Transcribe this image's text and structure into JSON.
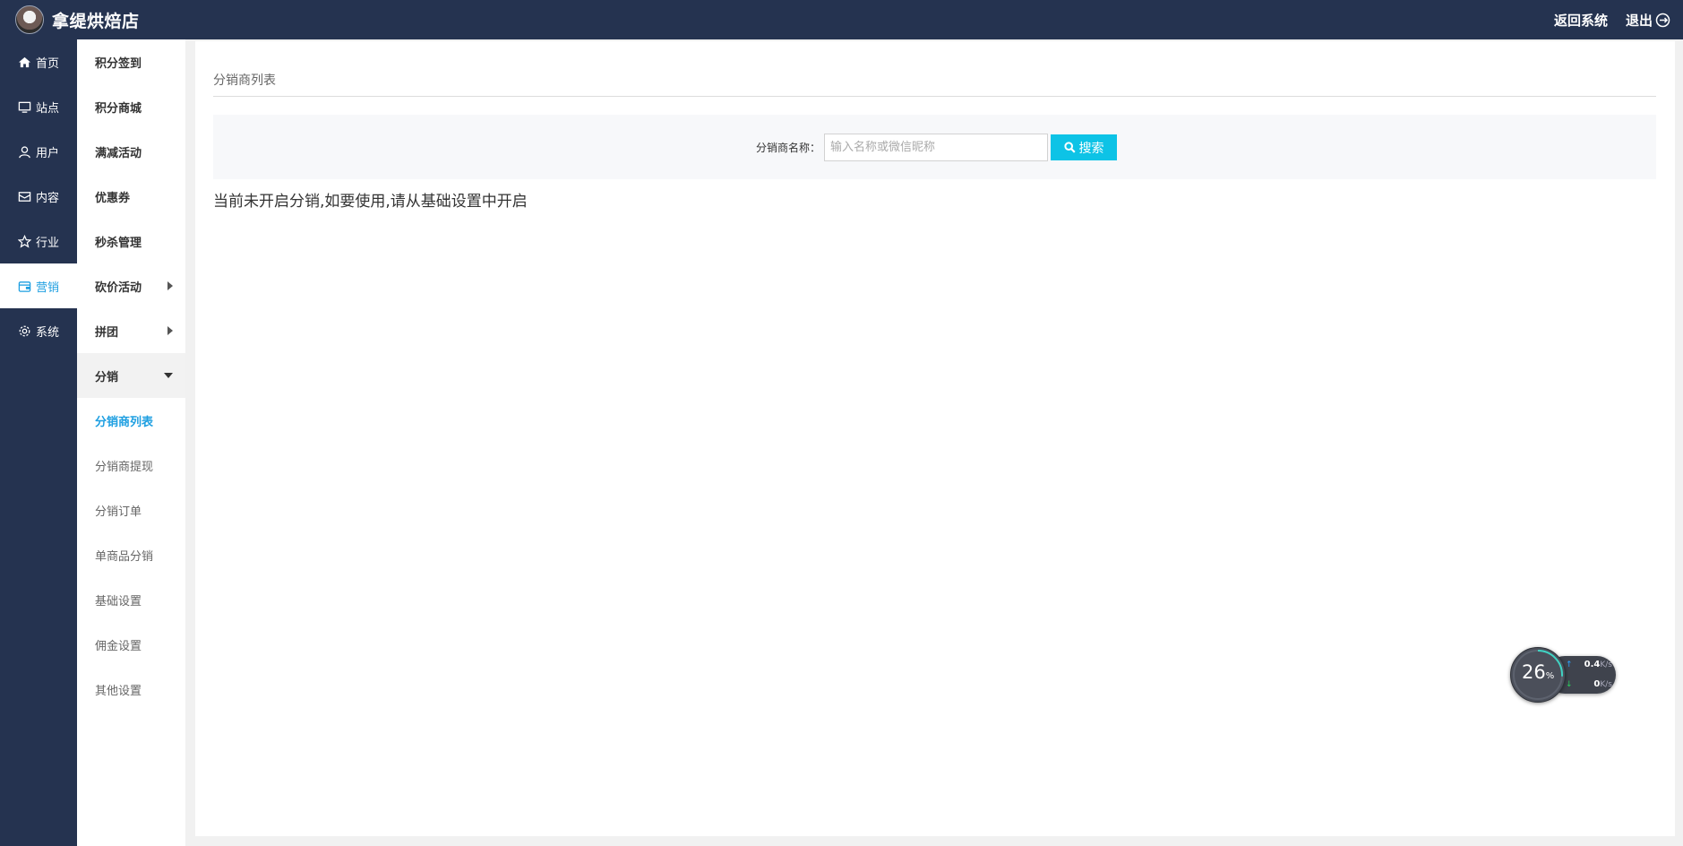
{
  "header": {
    "brand_name": "拿缇烘焙店",
    "return_label": "返回系统",
    "logout_label": "退出"
  },
  "primary_nav": [
    {
      "label": "首页",
      "icon": "home-icon",
      "active": false
    },
    {
      "label": "站点",
      "icon": "monitor-icon",
      "active": false
    },
    {
      "label": "用户",
      "icon": "user-icon",
      "active": false
    },
    {
      "label": "内容",
      "icon": "mail-icon",
      "active": false
    },
    {
      "label": "行业",
      "icon": "star-icon",
      "active": false
    },
    {
      "label": "营销",
      "icon": "wallet-icon",
      "active": true
    },
    {
      "label": "系统",
      "icon": "gear-icon",
      "active": false
    }
  ],
  "secondary_nav": {
    "items": [
      {
        "label": "积分签到"
      },
      {
        "label": "积分商城"
      },
      {
        "label": "满减活动"
      },
      {
        "label": "优惠券"
      },
      {
        "label": "秒杀管理"
      },
      {
        "label": "砍价活动"
      },
      {
        "label": "拼团"
      },
      {
        "label": "分销"
      }
    ],
    "subitems": [
      {
        "label": "分销商列表",
        "active": true
      },
      {
        "label": "分销商提现"
      },
      {
        "label": "分销订单"
      },
      {
        "label": "单商品分销"
      },
      {
        "label": "基础设置"
      },
      {
        "label": "佣金设置"
      },
      {
        "label": "其他设置"
      }
    ]
  },
  "main": {
    "page_title": "分销商列表",
    "search": {
      "label": "分销商名称：",
      "placeholder": "输入名称或微信昵称",
      "value": "",
      "button_label": "搜索"
    },
    "notice": "当前未开启分销,如要使用,请从基础设置中开启"
  },
  "net_widget": {
    "percent": "26",
    "percent_unit": "%",
    "progress": 0.26,
    "upload_value": "0.4",
    "upload_unit": "K/s",
    "download_value": "0",
    "download_unit": "K/s"
  },
  "colors": {
    "topbar_bg": "#253350",
    "accent": "#1e9fe1",
    "search_button": "#0dc3e6"
  }
}
